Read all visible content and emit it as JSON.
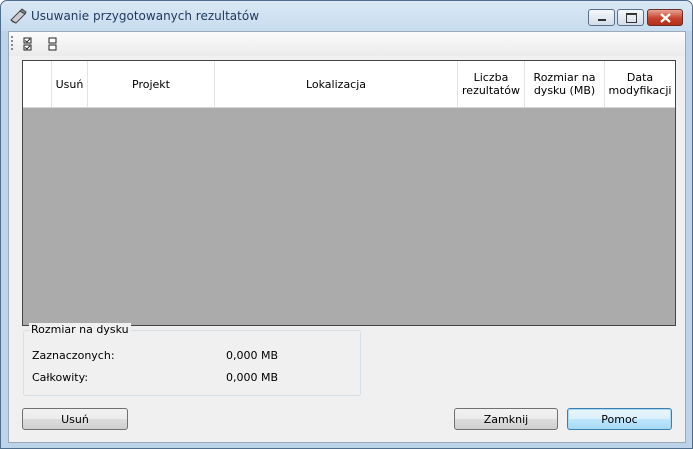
{
  "window": {
    "title": "Usuwanie przygotowanych rezultatów"
  },
  "toolbar": {
    "items": [
      "check-all-icon",
      "uncheck-all-icon"
    ]
  },
  "grid": {
    "columns": [
      "",
      "Usuń",
      "Projekt",
      "Lokalizacja",
      "Liczba rezultatów",
      "Rozmiar na dysku (MB)",
      "Data modyfikacji"
    ],
    "rows": []
  },
  "disk_size": {
    "title": "Rozmiar na dysku",
    "selected_label": "Zaznaczonych:",
    "selected_value": "0,000 MB",
    "total_label": "Całkowity:",
    "total_value": "0,000 MB"
  },
  "buttons": {
    "delete": "Usuń",
    "close": "Zamknij",
    "help": "Pomoc"
  }
}
